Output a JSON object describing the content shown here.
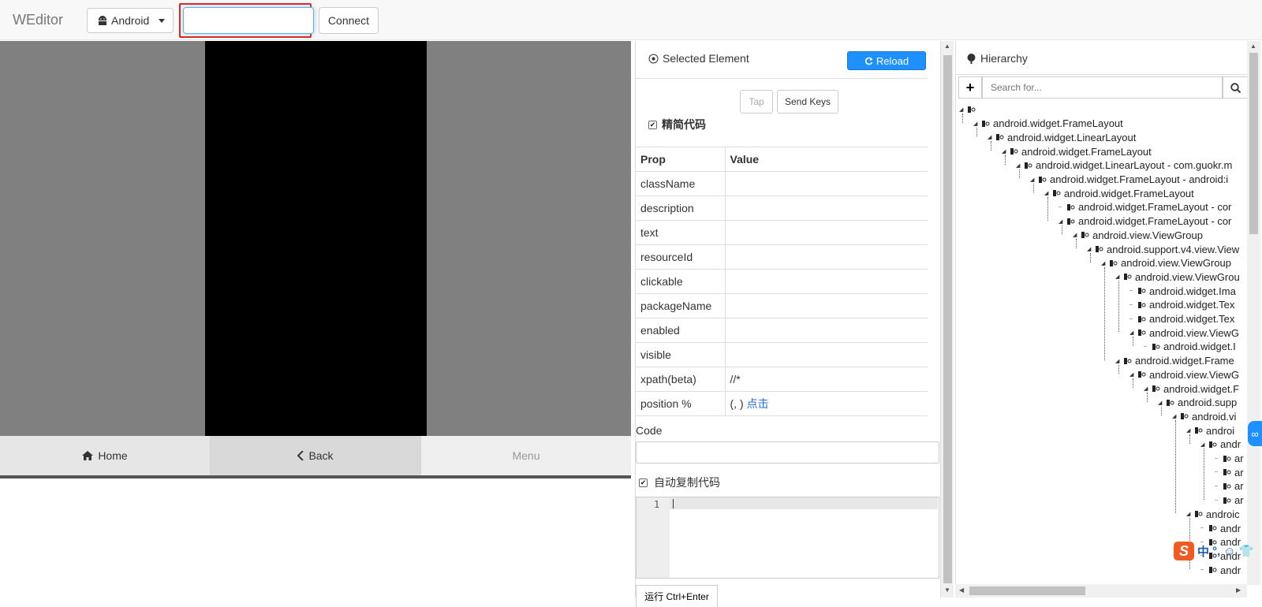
{
  "app": {
    "brand": "WEditor"
  },
  "toolbar": {
    "platform": {
      "label": "Android",
      "icon": "android-icon"
    },
    "device_input": {
      "value": "",
      "placeholder": ""
    },
    "connect_label": "Connect"
  },
  "screen": {
    "nav": {
      "home_label": "Home",
      "back_label": "Back",
      "menu_label": "Menu"
    }
  },
  "selected_element": {
    "title": "Selected Element",
    "reload_label": "Reload",
    "tap_label": "Tap",
    "send_keys_label": "Send Keys",
    "simplify_label": "精简代码",
    "simplify_checked": true,
    "table": {
      "headers": [
        "Prop",
        "Value"
      ],
      "rows": [
        {
          "prop": "className",
          "value": ""
        },
        {
          "prop": "description",
          "value": ""
        },
        {
          "prop": "text",
          "value": ""
        },
        {
          "prop": "resourceId",
          "value": ""
        },
        {
          "prop": "clickable",
          "value": ""
        },
        {
          "prop": "packageName",
          "value": ""
        },
        {
          "prop": "enabled",
          "value": ""
        },
        {
          "prop": "visible",
          "value": ""
        },
        {
          "prop": "xpath(beta)",
          "value": "//*"
        },
        {
          "prop": "position %",
          "value": "(, )",
          "link": "点击"
        }
      ]
    },
    "code_label": "Code",
    "auto_copy_label": "自动复制代码",
    "auto_copy_checked": true,
    "editor_line": "1",
    "run_label": "运行 Ctrl+Enter"
  },
  "hierarchy": {
    "title": "Hierarchy",
    "search_placeholder": "Search for...",
    "nodes": [
      {
        "label": "",
        "depth": 0
      },
      {
        "label": "android.widget.FrameLayout",
        "depth": 1
      },
      {
        "label": "android.widget.LinearLayout",
        "depth": 2
      },
      {
        "label": "android.widget.FrameLayout",
        "depth": 3
      },
      {
        "label": "android.widget.LinearLayout - com.guokr.m",
        "depth": 4
      },
      {
        "label": "android.widget.FrameLayout - android:i",
        "depth": 5
      },
      {
        "label": "android.widget.FrameLayout",
        "depth": 6
      },
      {
        "label": "android.widget.FrameLayout - cor",
        "depth": 7
      },
      {
        "label": "android.widget.FrameLayout - cor",
        "depth": 7
      },
      {
        "label": "android.view.ViewGroup",
        "depth": 8
      },
      {
        "label": "android.support.v4.view.View",
        "depth": 9
      },
      {
        "label": "android.view.ViewGroup",
        "depth": 10
      },
      {
        "label": "android.view.ViewGrou",
        "depth": 11
      },
      {
        "label": "android.widget.Ima",
        "depth": 12
      },
      {
        "label": "android.widget.Tex",
        "depth": 12
      },
      {
        "label": "android.widget.Tex",
        "depth": 12
      },
      {
        "label": "android.view.ViewG",
        "depth": 12
      },
      {
        "label": "android.widget.I",
        "depth": 13
      },
      {
        "label": "android.widget.Frame",
        "depth": 11
      },
      {
        "label": "android.view.ViewG",
        "depth": 12
      },
      {
        "label": "android.widget.F",
        "depth": 13
      },
      {
        "label": "android.supp",
        "depth": 14
      },
      {
        "label": "android.vi",
        "depth": 15
      },
      {
        "label": "androi",
        "depth": 16
      },
      {
        "label": "andr",
        "depth": 17
      },
      {
        "label": "ar",
        "depth": 18
      },
      {
        "label": "ar",
        "depth": 18
      },
      {
        "label": "ar",
        "depth": 18
      },
      {
        "label": "ar",
        "depth": 18
      },
      {
        "label": "androic",
        "depth": 16
      },
      {
        "label": "andr",
        "depth": 17
      },
      {
        "label": "andr",
        "depth": 17
      },
      {
        "label": "andr",
        "depth": 17
      },
      {
        "label": "andr",
        "depth": 17
      }
    ]
  },
  "ime": {
    "logo": "S",
    "mode": "中",
    "punct": "°,",
    "emoji": "☺",
    "skin": "👕"
  },
  "colors": {
    "accent": "#1e90ff",
    "highlight": "#e2231a",
    "screen_bg": "#808080"
  }
}
